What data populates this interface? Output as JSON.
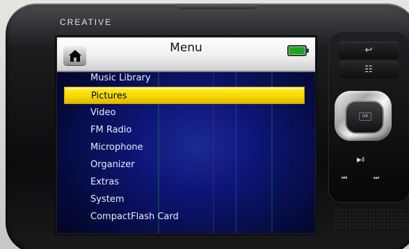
{
  "device": {
    "brand": "CREATIVE"
  },
  "screen": {
    "title": "Menu",
    "home_icon": "home-icon",
    "battery_icon": "battery-icon",
    "selected_item": "Pictures",
    "items": [
      {
        "label": "Music Library"
      },
      {
        "label": "Pictures"
      },
      {
        "label": "Video"
      },
      {
        "label": "FM Radio"
      },
      {
        "label": "Microphone"
      },
      {
        "label": "Organizer"
      },
      {
        "label": "Extras"
      },
      {
        "label": "System"
      },
      {
        "label": "CompactFlash Card"
      }
    ]
  },
  "controls": {
    "ok_label": "OK",
    "back_icon": "back-icon",
    "options_icon": "options-icon",
    "play_pause_icon": "play-pause-icon",
    "previous_icon": "previous-icon",
    "next_icon": "next-icon"
  },
  "colors": {
    "selection": "#f5d900",
    "battery": "#1fa31f",
    "screen_blue": "#0d1678"
  }
}
